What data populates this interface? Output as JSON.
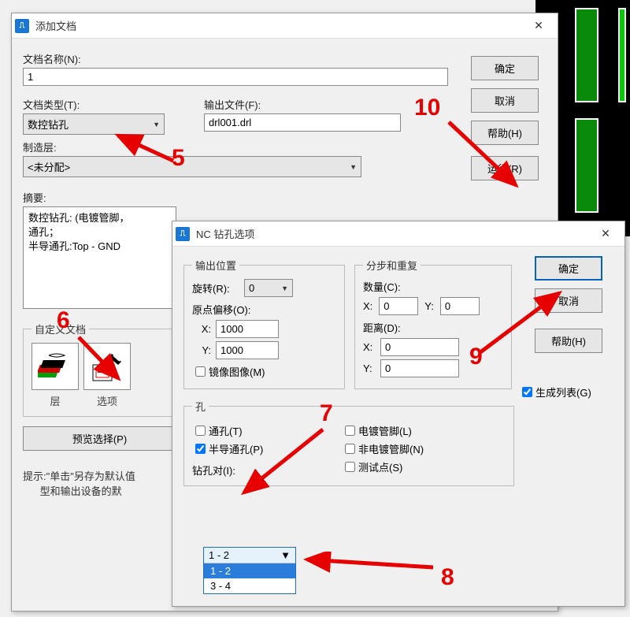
{
  "dialog1": {
    "title": "添加文档",
    "nameLabel": "文档名称(N):",
    "nameValue": "1",
    "typeLabel": "文档类型(T):",
    "typeValue": "数控钻孔",
    "outfileLabel": "输出文件(F):",
    "outfileValue": "drl001.drl",
    "layerLabel": "制造层:",
    "layerValue": "<未分配>",
    "summaryLabel": "摘要:",
    "summaryLine1": "数控钻孔: (电镀管脚，",
    "summaryLine2": "通孔；",
    "summaryLine3": "半导通孔:Top - GND",
    "customLabel": "自定义文档",
    "layersCap": "层",
    "optionsCap": "选项",
    "previewBtn": "预览选择(P)",
    "hint1": "提示:\"单击\"另存为默认值",
    "hint2": "型和输出设备的默",
    "ok": "确定",
    "cancel": "取消",
    "help": "帮助(H)",
    "run": "运行(R)"
  },
  "dialog2": {
    "title": "NC 钻孔选项",
    "outPosGroup": "输出位置",
    "rotateLabel": "旋转(R):",
    "rotateValue": "0",
    "originLabel": "原点偏移(O):",
    "originX": "1000",
    "originY": "1000",
    "xLabel": "X:",
    "yLabel": "Y:",
    "mirror": "镜像图像(M)",
    "stepGroup": "分步和重复",
    "countLabel": "数量(C):",
    "countX": "0",
    "countY": "0",
    "distLabel": "距离(D):",
    "distX": "0",
    "distY": "0",
    "holesGroup": "孔",
    "throughHole": "通孔(T)",
    "partialHole": "半导通孔(P)",
    "platedPin": "电镀管脚(L)",
    "unplatedPin": "非电镀管脚(N)",
    "testPoint": "测试点(S)",
    "drillPairLabel": "钻孔对(I):",
    "drillPairValue": "1 - 2",
    "drillPairOpt1": "1 - 2",
    "drillPairOpt2": "3 - 4",
    "genList": "生成列表(G)",
    "ok": "确定",
    "cancel": "取消",
    "help": "帮助(H)"
  },
  "anno": {
    "n5": "5",
    "n6": "6",
    "n7": "7",
    "n8": "8",
    "n9": "9",
    "n10": "10"
  }
}
